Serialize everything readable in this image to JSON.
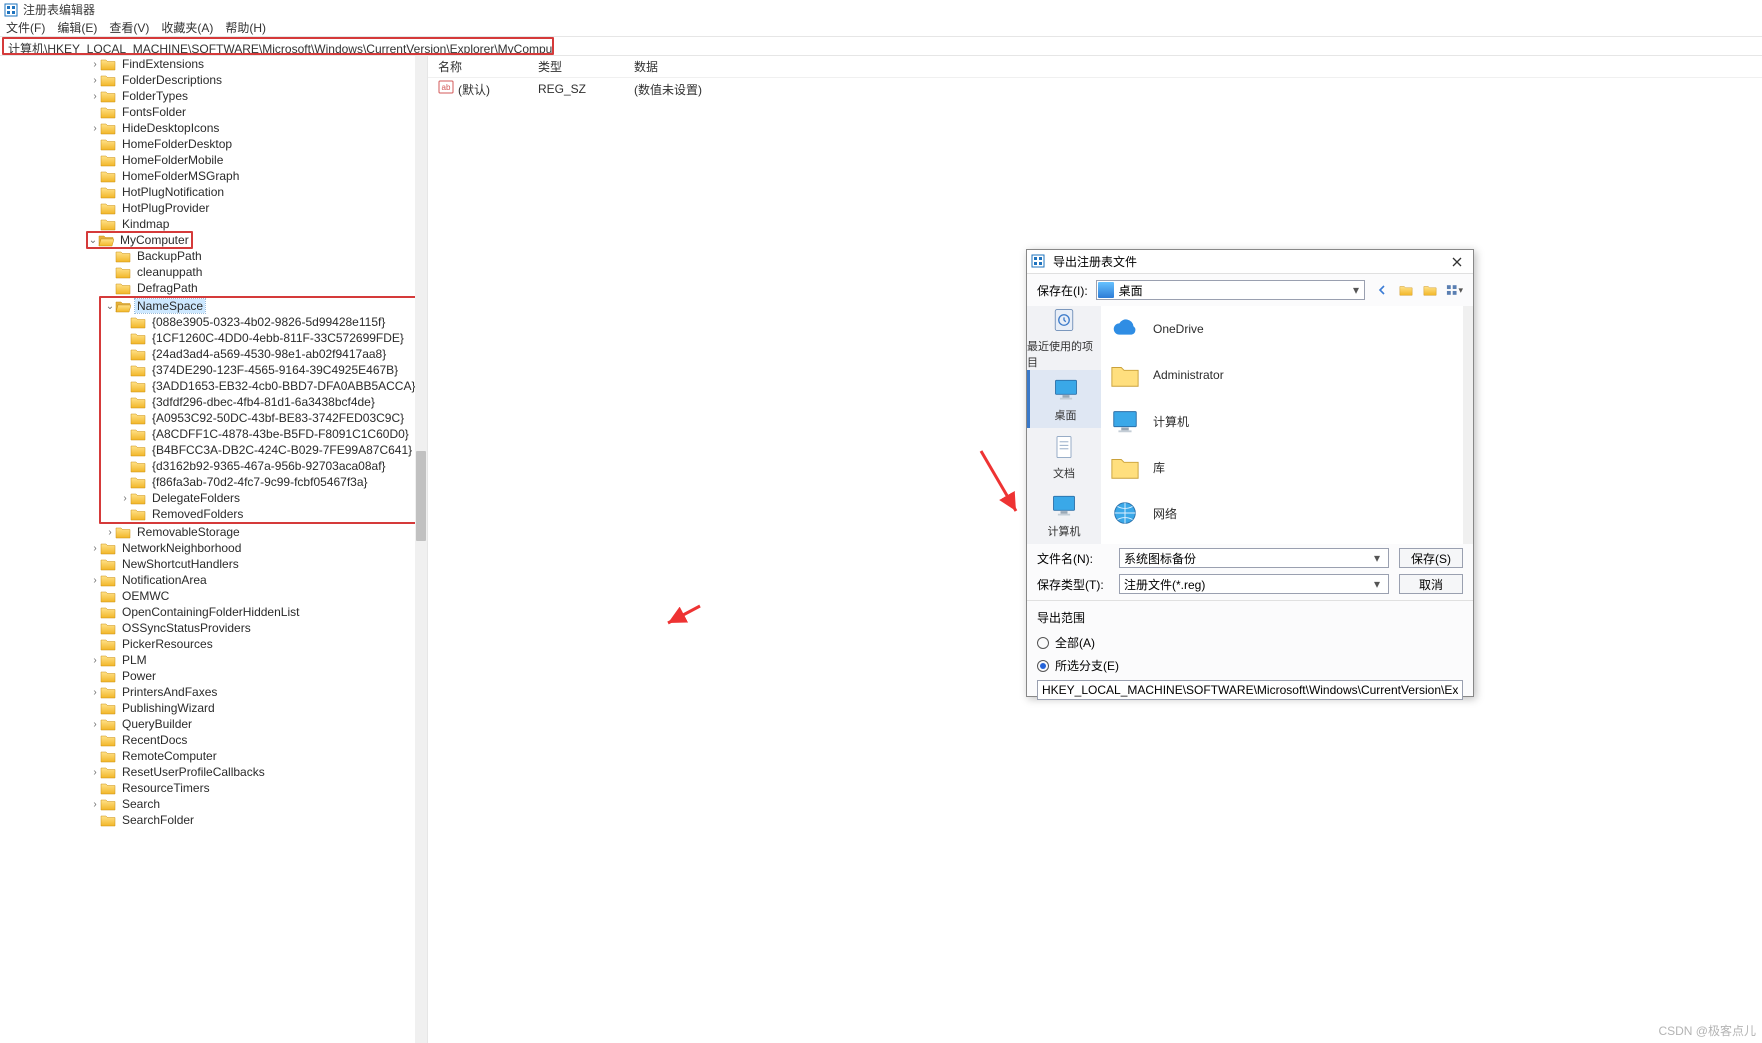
{
  "app": {
    "title": "注册表编辑器",
    "menus": [
      "文件(F)",
      "编辑(E)",
      "查看(V)",
      "收藏夹(A)",
      "帮助(H)"
    ],
    "path": "计算机\\HKEY_LOCAL_MACHINE\\SOFTWARE\\Microsoft\\Windows\\CurrentVersion\\Explorer\\MyComputer\\NameSpace"
  },
  "tree": {
    "items": [
      {
        "depth": 6,
        "chev": ">",
        "name": "FindExtensions"
      },
      {
        "depth": 6,
        "chev": ">",
        "name": "FolderDescriptions"
      },
      {
        "depth": 6,
        "chev": ">",
        "name": "FolderTypes"
      },
      {
        "depth": 6,
        "chev": "",
        "name": "FontsFolder"
      },
      {
        "depth": 6,
        "chev": ">",
        "name": "HideDesktopIcons"
      },
      {
        "depth": 6,
        "chev": "",
        "name": "HomeFolderDesktop"
      },
      {
        "depth": 6,
        "chev": "",
        "name": "HomeFolderMobile"
      },
      {
        "depth": 6,
        "chev": "",
        "name": "HomeFolderMSGraph"
      },
      {
        "depth": 6,
        "chev": "",
        "name": "HotPlugNotification"
      },
      {
        "depth": 6,
        "chev": "",
        "name": "HotPlugProvider"
      },
      {
        "depth": 6,
        "chev": "",
        "name": "Kindmap"
      },
      {
        "depth": 6,
        "chev": "v",
        "name": "MyComputer",
        "hl": "red",
        "open": true
      },
      {
        "depth": 7,
        "chev": "",
        "name": "BackupPath"
      },
      {
        "depth": 7,
        "chev": "",
        "name": "cleanuppath"
      },
      {
        "depth": 7,
        "chev": "",
        "name": "DefragPath"
      },
      {
        "depth": 7,
        "chev": "v",
        "name": "NameSpace",
        "hl": "red",
        "open": true,
        "selected": true,
        "boxStart": true
      },
      {
        "depth": 8,
        "chev": "",
        "name": "{088e3905-0323-4b02-9826-5d99428e115f}"
      },
      {
        "depth": 8,
        "chev": "",
        "name": "{1CF1260C-4DD0-4ebb-811F-33C572699FDE}"
      },
      {
        "depth": 8,
        "chev": "",
        "name": "{24ad3ad4-a569-4530-98e1-ab02f9417aa8}"
      },
      {
        "depth": 8,
        "chev": "",
        "name": "{374DE290-123F-4565-9164-39C4925E467B}"
      },
      {
        "depth": 8,
        "chev": "",
        "name": "{3ADD1653-EB32-4cb0-BBD7-DFA0ABB5ACCA}"
      },
      {
        "depth": 8,
        "chev": "",
        "name": "{3dfdf296-dbec-4fb4-81d1-6a3438bcf4de}"
      },
      {
        "depth": 8,
        "chev": "",
        "name": "{A0953C92-50DC-43bf-BE83-3742FED03C9C}"
      },
      {
        "depth": 8,
        "chev": "",
        "name": "{A8CDFF1C-4878-43be-B5FD-F8091C1C60D0}"
      },
      {
        "depth": 8,
        "chev": "",
        "name": "{B4BFCC3A-DB2C-424C-B029-7FE99A87C641}"
      },
      {
        "depth": 8,
        "chev": "",
        "name": "{d3162b92-9365-467a-956b-92703aca08af}"
      },
      {
        "depth": 8,
        "chev": "",
        "name": "{f86fa3ab-70d2-4fc7-9c99-fcbf05467f3a}"
      },
      {
        "depth": 8,
        "chev": ">",
        "name": "DelegateFolders"
      },
      {
        "depth": 8,
        "chev": "",
        "name": "RemovedFolders",
        "boxEnd": true
      },
      {
        "depth": 7,
        "chev": ">",
        "name": "RemovableStorage"
      },
      {
        "depth": 6,
        "chev": ">",
        "name": "NetworkNeighborhood"
      },
      {
        "depth": 6,
        "chev": "",
        "name": "NewShortcutHandlers"
      },
      {
        "depth": 6,
        "chev": ">",
        "name": "NotificationArea"
      },
      {
        "depth": 6,
        "chev": "",
        "name": "OEMWC"
      },
      {
        "depth": 6,
        "chev": "",
        "name": "OpenContainingFolderHiddenList"
      },
      {
        "depth": 6,
        "chev": "",
        "name": "OSSyncStatusProviders"
      },
      {
        "depth": 6,
        "chev": "",
        "name": "PickerResources"
      },
      {
        "depth": 6,
        "chev": ">",
        "name": "PLM"
      },
      {
        "depth": 6,
        "chev": "",
        "name": "Power"
      },
      {
        "depth": 6,
        "chev": ">",
        "name": "PrintersAndFaxes"
      },
      {
        "depth": 6,
        "chev": "",
        "name": "PublishingWizard"
      },
      {
        "depth": 6,
        "chev": ">",
        "name": "QueryBuilder"
      },
      {
        "depth": 6,
        "chev": "",
        "name": "RecentDocs"
      },
      {
        "depth": 6,
        "chev": "",
        "name": "RemoteComputer"
      },
      {
        "depth": 6,
        "chev": ">",
        "name": "ResetUserProfileCallbacks"
      },
      {
        "depth": 6,
        "chev": "",
        "name": "ResourceTimers"
      },
      {
        "depth": 6,
        "chev": ">",
        "name": "Search"
      },
      {
        "depth": 6,
        "chev": "",
        "name": "SearchFolder"
      }
    ]
  },
  "list": {
    "headers": {
      "name": "名称",
      "type": "类型",
      "data": "数据"
    },
    "rows": [
      {
        "name": "(默认)",
        "type": "REG_SZ",
        "data": "(数值未设置)"
      }
    ]
  },
  "dialog": {
    "title": "导出注册表文件",
    "saveInLabel": "保存在(I):",
    "saveInValue": "桌面",
    "left": [
      {
        "name": "最近使用的项目",
        "icon": "recent"
      },
      {
        "name": "桌面",
        "icon": "desktop",
        "selected": true
      },
      {
        "name": "文档",
        "icon": "docs"
      },
      {
        "name": "计算机",
        "icon": "pc"
      }
    ],
    "right": [
      {
        "name": "OneDrive",
        "icon": "cloud"
      },
      {
        "name": "Administrator",
        "icon": "folder"
      },
      {
        "name": "计算机",
        "icon": "pc"
      },
      {
        "name": "库",
        "icon": "folder"
      },
      {
        "name": "网络",
        "icon": "net"
      }
    ],
    "filenameLabel": "文件名(N):",
    "filenameValue": "系统图标备份",
    "filetypeLabel": "保存类型(T):",
    "filetypeValue": "注册文件(*.reg)",
    "saveBtn": "保存(S)",
    "cancelBtn": "取消",
    "exportGroup": "导出范围",
    "radioAll": "全部(A)",
    "radioBranch": "所选分支(E)",
    "branchPath": "HKEY_LOCAL_MACHINE\\SOFTWARE\\Microsoft\\Windows\\CurrentVersion\\Explorer\\"
  },
  "watermark": "CSDN @极客点儿"
}
